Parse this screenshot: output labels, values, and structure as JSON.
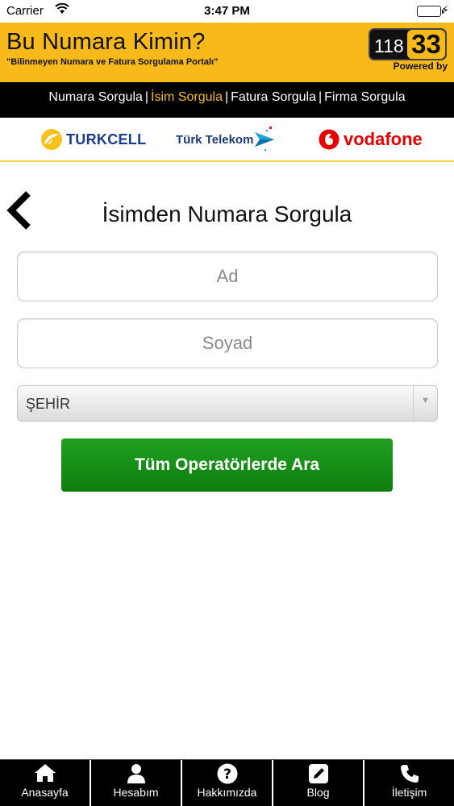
{
  "status_bar": {
    "carrier": "Carrier",
    "time": "3:47 PM"
  },
  "header": {
    "title": "Bu Numara Kimin?",
    "subtitle": "\"Bilinmeyen Numara ve Fatura Sorgulama Portalı\"",
    "logo_left": "118",
    "logo_right": "33",
    "powered_by": "Powered by"
  },
  "nav": {
    "items": [
      {
        "label": "Numara Sorgula"
      },
      {
        "label": "İsim Sorgula"
      },
      {
        "label": "Fatura Sorgula"
      },
      {
        "label": "Firma Sorgula"
      }
    ],
    "separator": "|",
    "active_index": 1
  },
  "operators": {
    "turkcell": "TURKCELL",
    "telekom": "Türk Telekom",
    "vodafone": "vodafone"
  },
  "page": {
    "heading": "İsimden Numara Sorgula",
    "back_icon": "chevron-left-icon"
  },
  "form": {
    "first_name_placeholder": "Ad",
    "last_name_placeholder": "Soyad",
    "city_selected": "ŞEHİR",
    "search_button": "Tüm Operatörlerde Ara"
  },
  "tabbar": {
    "items": [
      {
        "label": "Anasayfa",
        "icon": "home-icon"
      },
      {
        "label": "Hesabım",
        "icon": "user-icon"
      },
      {
        "label": "Hakkımızda",
        "icon": "question-icon"
      },
      {
        "label": "Blog",
        "icon": "pencil-icon"
      },
      {
        "label": "İletişim",
        "icon": "phone-icon"
      }
    ]
  },
  "colors": {
    "brand_yellow": "#f8ba1a",
    "nav_active": "#f8ba1a",
    "button_green": "#129012",
    "turkcell_blue": "#1a3c8c",
    "vodafone_red": "#e60000"
  }
}
